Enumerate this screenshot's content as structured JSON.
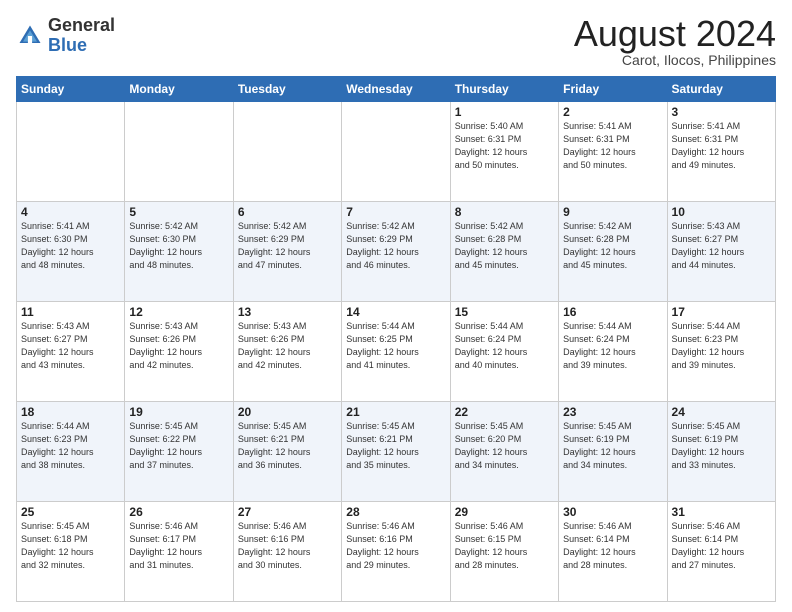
{
  "header": {
    "logo_general": "General",
    "logo_blue": "Blue",
    "month_title": "August 2024",
    "location": "Carot, Ilocos, Philippines"
  },
  "weekdays": [
    "Sunday",
    "Monday",
    "Tuesday",
    "Wednesday",
    "Thursday",
    "Friday",
    "Saturday"
  ],
  "weeks": [
    [
      {
        "day": "",
        "info": ""
      },
      {
        "day": "",
        "info": ""
      },
      {
        "day": "",
        "info": ""
      },
      {
        "day": "",
        "info": ""
      },
      {
        "day": "1",
        "info": "Sunrise: 5:40 AM\nSunset: 6:31 PM\nDaylight: 12 hours\nand 50 minutes."
      },
      {
        "day": "2",
        "info": "Sunrise: 5:41 AM\nSunset: 6:31 PM\nDaylight: 12 hours\nand 50 minutes."
      },
      {
        "day": "3",
        "info": "Sunrise: 5:41 AM\nSunset: 6:31 PM\nDaylight: 12 hours\nand 49 minutes."
      }
    ],
    [
      {
        "day": "4",
        "info": "Sunrise: 5:41 AM\nSunset: 6:30 PM\nDaylight: 12 hours\nand 48 minutes."
      },
      {
        "day": "5",
        "info": "Sunrise: 5:42 AM\nSunset: 6:30 PM\nDaylight: 12 hours\nand 48 minutes."
      },
      {
        "day": "6",
        "info": "Sunrise: 5:42 AM\nSunset: 6:29 PM\nDaylight: 12 hours\nand 47 minutes."
      },
      {
        "day": "7",
        "info": "Sunrise: 5:42 AM\nSunset: 6:29 PM\nDaylight: 12 hours\nand 46 minutes."
      },
      {
        "day": "8",
        "info": "Sunrise: 5:42 AM\nSunset: 6:28 PM\nDaylight: 12 hours\nand 45 minutes."
      },
      {
        "day": "9",
        "info": "Sunrise: 5:42 AM\nSunset: 6:28 PM\nDaylight: 12 hours\nand 45 minutes."
      },
      {
        "day": "10",
        "info": "Sunrise: 5:43 AM\nSunset: 6:27 PM\nDaylight: 12 hours\nand 44 minutes."
      }
    ],
    [
      {
        "day": "11",
        "info": "Sunrise: 5:43 AM\nSunset: 6:27 PM\nDaylight: 12 hours\nand 43 minutes."
      },
      {
        "day": "12",
        "info": "Sunrise: 5:43 AM\nSunset: 6:26 PM\nDaylight: 12 hours\nand 42 minutes."
      },
      {
        "day": "13",
        "info": "Sunrise: 5:43 AM\nSunset: 6:26 PM\nDaylight: 12 hours\nand 42 minutes."
      },
      {
        "day": "14",
        "info": "Sunrise: 5:44 AM\nSunset: 6:25 PM\nDaylight: 12 hours\nand 41 minutes."
      },
      {
        "day": "15",
        "info": "Sunrise: 5:44 AM\nSunset: 6:24 PM\nDaylight: 12 hours\nand 40 minutes."
      },
      {
        "day": "16",
        "info": "Sunrise: 5:44 AM\nSunset: 6:24 PM\nDaylight: 12 hours\nand 39 minutes."
      },
      {
        "day": "17",
        "info": "Sunrise: 5:44 AM\nSunset: 6:23 PM\nDaylight: 12 hours\nand 39 minutes."
      }
    ],
    [
      {
        "day": "18",
        "info": "Sunrise: 5:44 AM\nSunset: 6:23 PM\nDaylight: 12 hours\nand 38 minutes."
      },
      {
        "day": "19",
        "info": "Sunrise: 5:45 AM\nSunset: 6:22 PM\nDaylight: 12 hours\nand 37 minutes."
      },
      {
        "day": "20",
        "info": "Sunrise: 5:45 AM\nSunset: 6:21 PM\nDaylight: 12 hours\nand 36 minutes."
      },
      {
        "day": "21",
        "info": "Sunrise: 5:45 AM\nSunset: 6:21 PM\nDaylight: 12 hours\nand 35 minutes."
      },
      {
        "day": "22",
        "info": "Sunrise: 5:45 AM\nSunset: 6:20 PM\nDaylight: 12 hours\nand 34 minutes."
      },
      {
        "day": "23",
        "info": "Sunrise: 5:45 AM\nSunset: 6:19 PM\nDaylight: 12 hours\nand 34 minutes."
      },
      {
        "day": "24",
        "info": "Sunrise: 5:45 AM\nSunset: 6:19 PM\nDaylight: 12 hours\nand 33 minutes."
      }
    ],
    [
      {
        "day": "25",
        "info": "Sunrise: 5:45 AM\nSunset: 6:18 PM\nDaylight: 12 hours\nand 32 minutes."
      },
      {
        "day": "26",
        "info": "Sunrise: 5:46 AM\nSunset: 6:17 PM\nDaylight: 12 hours\nand 31 minutes."
      },
      {
        "day": "27",
        "info": "Sunrise: 5:46 AM\nSunset: 6:16 PM\nDaylight: 12 hours\nand 30 minutes."
      },
      {
        "day": "28",
        "info": "Sunrise: 5:46 AM\nSunset: 6:16 PM\nDaylight: 12 hours\nand 29 minutes."
      },
      {
        "day": "29",
        "info": "Sunrise: 5:46 AM\nSunset: 6:15 PM\nDaylight: 12 hours\nand 28 minutes."
      },
      {
        "day": "30",
        "info": "Sunrise: 5:46 AM\nSunset: 6:14 PM\nDaylight: 12 hours\nand 28 minutes."
      },
      {
        "day": "31",
        "info": "Sunrise: 5:46 AM\nSunset: 6:14 PM\nDaylight: 12 hours\nand 27 minutes."
      }
    ]
  ]
}
